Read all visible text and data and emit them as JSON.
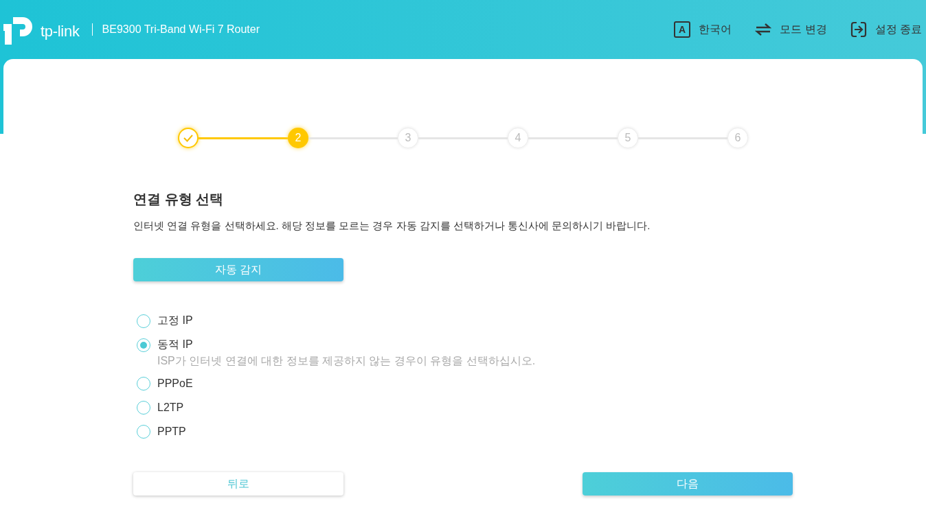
{
  "header": {
    "logo_text": "tp-link",
    "title": "BE9300 Tri-Band Wi-Fi 7 Router",
    "actions": [
      {
        "kind": "language",
        "icon_letter": "A",
        "label": "한국어"
      },
      {
        "kind": "mode",
        "label": "모드 변경"
      },
      {
        "kind": "exit",
        "label": "설정 종료"
      }
    ]
  },
  "steps": [
    {
      "completed": true,
      "selected": false
    },
    {
      "label": "2",
      "completed": false,
      "selected": true
    },
    {
      "label": "3",
      "completed": false,
      "selected": false
    },
    {
      "label": "4",
      "completed": false,
      "selected": false
    },
    {
      "label": "5",
      "completed": false,
      "selected": false
    },
    {
      "label": "6",
      "completed": false,
      "selected": false
    }
  ],
  "heading": "연결 유형 선택",
  "description": "인터넷 연결 유형을 선택하세요. 해당 정보를 모르는 경우 자동 감지를 선택하거나 통신사에 문의하시기 바랍니다.",
  "auto_detect_button": {
    "label": "자동 감지",
    "kind": "primary"
  },
  "options": [
    {
      "label": "고정 IP",
      "selected": false
    },
    {
      "label": "동적 IP",
      "selected": true,
      "hint": "ISP가 인터넷 연결에 대한 정보를 제공하지 않는 경우이 유형을 선택하십시오."
    },
    {
      "label": "PPPoE",
      "selected": false
    },
    {
      "label": "L2TP",
      "selected": false
    },
    {
      "label": "PPTP",
      "selected": false
    }
  ],
  "buttons": [
    {
      "label": "뒤로",
      "kind": "secondary"
    },
    {
      "label": "다음",
      "kind": "primary"
    }
  ]
}
